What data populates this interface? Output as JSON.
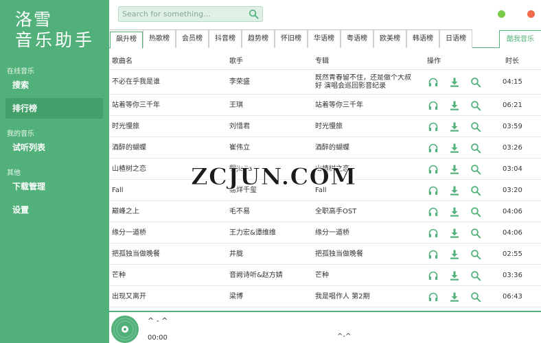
{
  "app": {
    "logo_line1": "洛雪",
    "logo_line2": "音乐助手"
  },
  "sidebar": {
    "sections": [
      {
        "title": "在线音乐",
        "items": [
          {
            "label": "搜索"
          },
          {
            "label": "排行榜"
          }
        ]
      },
      {
        "title": "我的音乐",
        "items": [
          {
            "label": "试听列表"
          }
        ]
      },
      {
        "title": "其他",
        "items": [
          {
            "label": "下载管理"
          },
          {
            "label": "设置"
          }
        ]
      }
    ],
    "active": "排行榜"
  },
  "search": {
    "placeholder": "Search for something...",
    "value": ""
  },
  "window_controls": {
    "minimize_color": "#7ccc4b",
    "close_color": "#f06b4a"
  },
  "tabs": {
    "items": [
      "飙升榜",
      "热歌榜",
      "会员榜",
      "抖音榜",
      "趋势榜",
      "怀旧榜",
      "华语榜",
      "粤语榜",
      "欧美榜",
      "韩语榜",
      "日语榜"
    ],
    "active_index": 0,
    "source": "酷我音乐"
  },
  "table": {
    "headers": {
      "song": "歌曲名",
      "artist": "歌手",
      "album": "专辑",
      "actions": "操作",
      "duration": "时长"
    },
    "rows": [
      {
        "song": "不必在乎我是谁",
        "artist": "李荣盛",
        "album": "既然青春留不住，还是做个大叔好 演唱会巡回影音纪录",
        "duration": "04:15"
      },
      {
        "song": "站着等你三千年",
        "artist": "王琪",
        "album": "站着等你三千年",
        "duration": "06:21"
      },
      {
        "song": "时光慢旅",
        "artist": "刘惜君",
        "album": "时光慢旅",
        "duration": "03:59"
      },
      {
        "song": "酒醉的蝴蝶",
        "artist": "崔伟立",
        "album": "酒醉的蝴蝶",
        "duration": "03:26"
      },
      {
        "song": "山楂树之恋",
        "artist": "程jiajia",
        "album": "山楂树之恋",
        "duration": "03:04"
      },
      {
        "song": "Fall",
        "artist": "易烊千玺",
        "album": "Fall",
        "duration": "03:20"
      },
      {
        "song": "巅峰之上",
        "artist": "毛不易",
        "album": "全职高手OST",
        "duration": "04:06"
      },
      {
        "song": "缘分一道桥",
        "artist": "王力宏&谭维维",
        "album": "缘分一道桥",
        "duration": "04:06"
      },
      {
        "song": "把孤独当做晚餐",
        "artist": "井胧",
        "album": "把孤独当做晚餐",
        "duration": "02:55"
      },
      {
        "song": "芒种",
        "artist": "音阙诗听&赵方婧",
        "album": "芒种",
        "duration": "03:36"
      },
      {
        "song": "出现又离开",
        "artist": "梁博",
        "album": "我是唱作人 第2期",
        "duration": "06:43"
      }
    ]
  },
  "player": {
    "title": "^ - ^",
    "current_time": "00:00",
    "center_text": "^-^"
  },
  "watermark": "ZCJUN.COM",
  "colors": {
    "accent": "#52b07a",
    "accent_dark": "#43a06b"
  }
}
